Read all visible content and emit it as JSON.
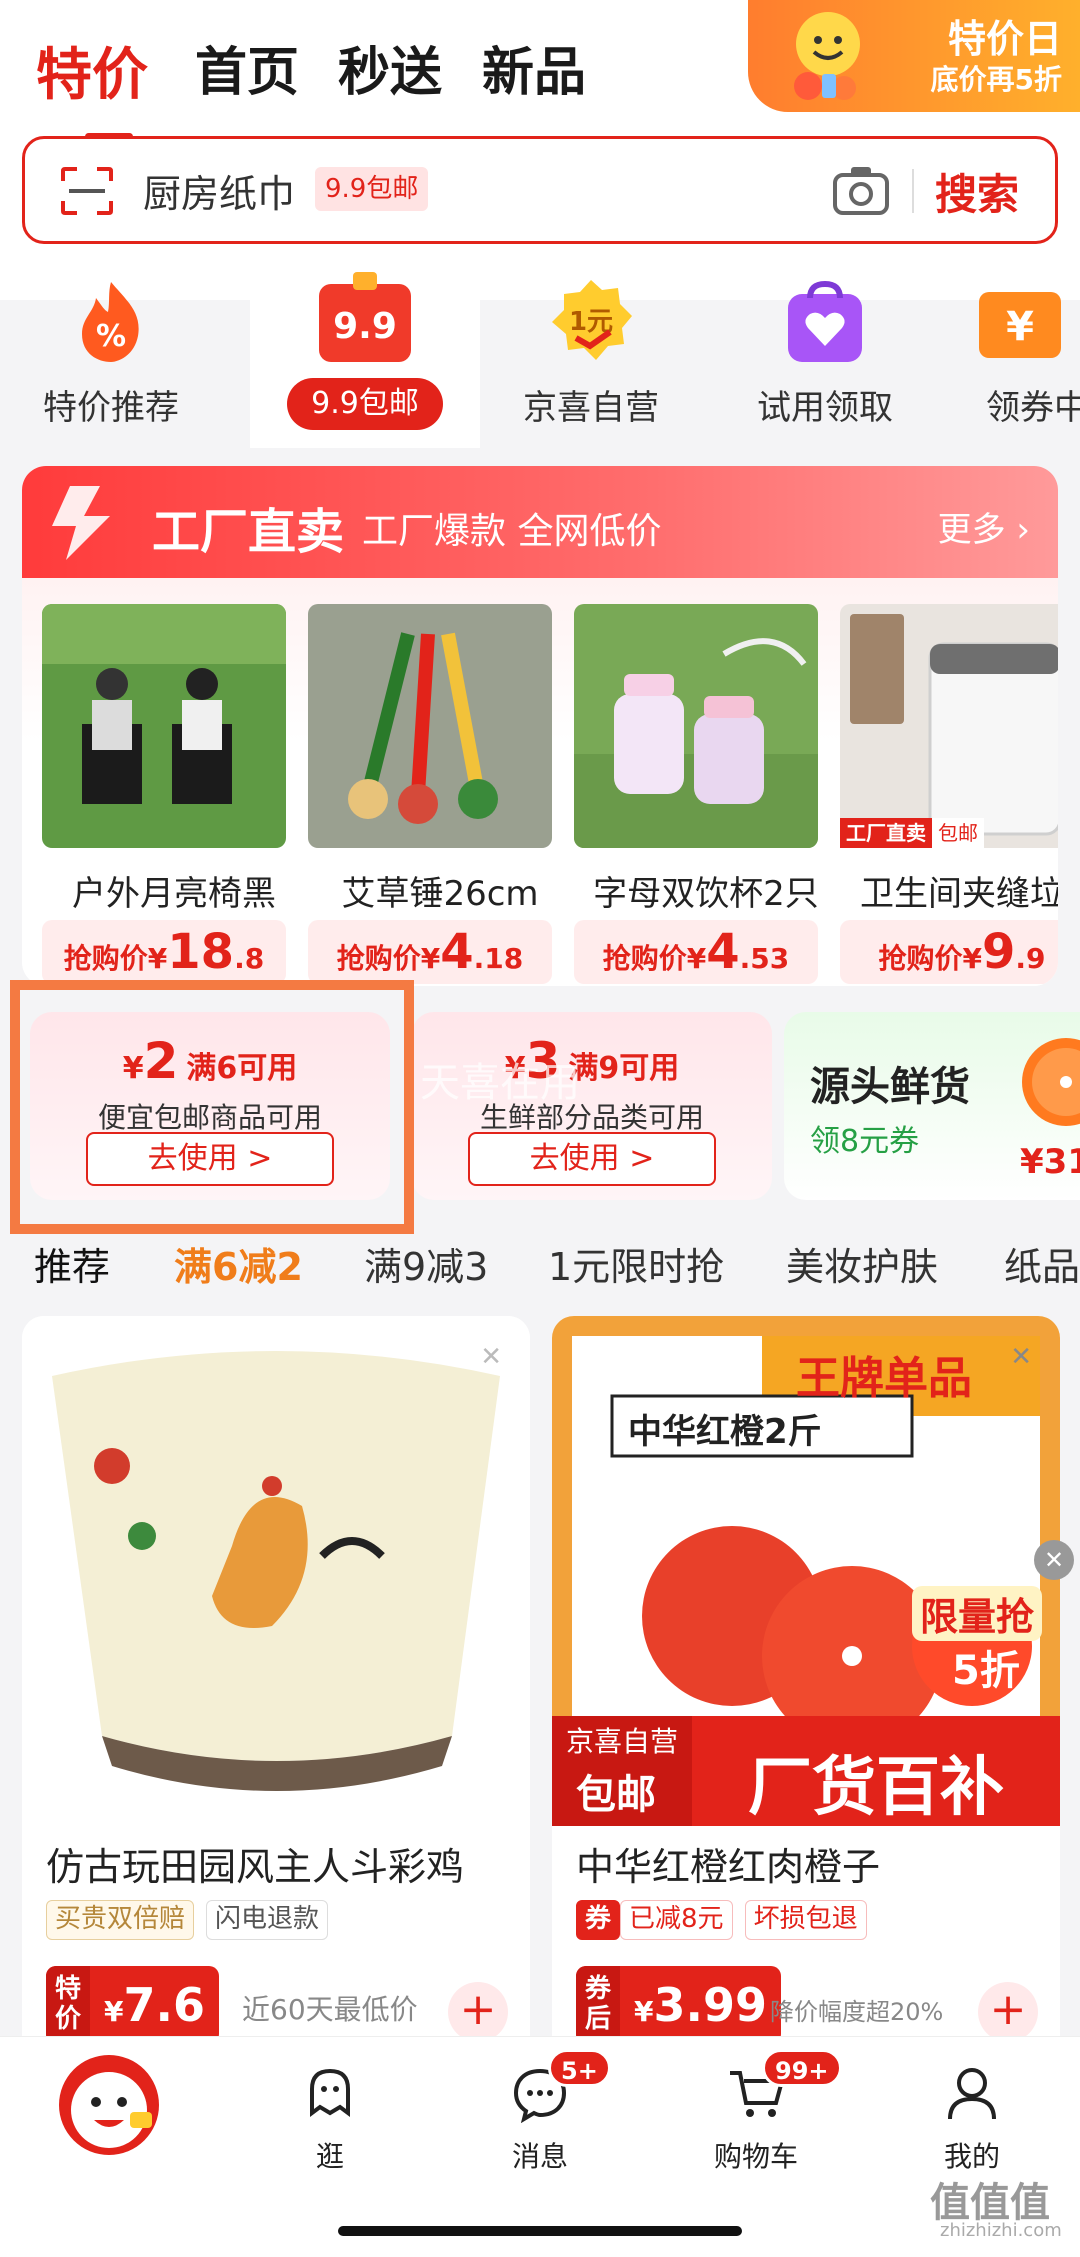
{
  "top_tabs": [
    {
      "label": "特价",
      "active": true
    },
    {
      "label": "首页"
    },
    {
      "label": "秒送"
    },
    {
      "label": "新品"
    }
  ],
  "promo_banner": {
    "line1": "特价日",
    "line2": "底价再5折"
  },
  "search": {
    "text": "厨房纸巾",
    "tag": "9.9包邮",
    "button": "搜索"
  },
  "categories": [
    {
      "label": "特价推荐",
      "icon": "fire-percent-icon"
    },
    {
      "label": "9.9包邮",
      "icon": "gift-box-9-9-icon",
      "selected": true,
      "icon_text": "9.9"
    },
    {
      "label": "京喜自营",
      "icon": "gold-coin-1yuan-icon",
      "icon_text": "1元"
    },
    {
      "label": "试用领取",
      "icon": "shopping-bag-heart-icon"
    },
    {
      "label": "领券中",
      "icon": "coupon-yen-icon"
    }
  ],
  "factory": {
    "title": "工厂直卖",
    "subtitle": "工厂爆款 全网低价",
    "more": "更多",
    "products": [
      {
        "name": "户外月亮椅黑",
        "price_label": "抢购价",
        "currency": "¥",
        "price_int": "18",
        "price_dec": ".8"
      },
      {
        "name": "艾草锤26cm",
        "price_label": "抢购价",
        "currency": "¥",
        "price_int": "4",
        "price_dec": ".18"
      },
      {
        "name": "字母双饮杯2只",
        "price_label": "抢购价",
        "currency": "¥",
        "price_int": "4",
        "price_dec": ".53"
      },
      {
        "name": "卫生间夹缝垃",
        "price_label": "抢购价",
        "currency": "¥",
        "price_int": "9",
        "price_dec": ".9",
        "badge1": "工厂直卖",
        "badge2": "包邮"
      }
    ]
  },
  "coupons": [
    {
      "currency": "¥",
      "amount": "2",
      "condition": "满6可用",
      "desc": "便宜包邮商品可用",
      "button": "去使用 >"
    },
    {
      "currency": "¥",
      "amount": "3",
      "condition": "满9可用",
      "desc": "生鲜部分品类可用",
      "button": "去使用 >"
    }
  ],
  "fresh": {
    "title": "源头鲜货",
    "subtitle": "领8元券",
    "price": "¥31."
  },
  "watermark": "天喜在用",
  "filters": [
    {
      "label": "推荐"
    },
    {
      "label": "满6减2",
      "active": true
    },
    {
      "label": "满9减3"
    },
    {
      "label": "1元限时抢"
    },
    {
      "label": "美妆护肤"
    },
    {
      "label": "纸品"
    }
  ],
  "cards": [
    {
      "title": "仿古玩田园风主人斗彩鸡",
      "tags": [
        "买贵双倍赔",
        "闪电退款"
      ],
      "price_label": "特价",
      "currency": "¥",
      "price": "7.6",
      "note": "近60天最低价"
    },
    {
      "title": "中华红橙红肉橙子",
      "tags": [
        "券",
        "已减8元",
        "坏损包退"
      ],
      "price_label": "券后",
      "currency": "¥",
      "price": "3.99",
      "note": "降价幅度超20%",
      "img_banner": "王牌单品",
      "img_sub": "中华红橙2斤",
      "img_limit": "限量抢",
      "img_discount": "5折",
      "img_badge1": "京喜自营",
      "img_badge2": "包邮",
      "img_slogan": "厂货百补"
    }
  ],
  "bottom_nav": [
    {
      "label": "",
      "icon": "mascot-icon"
    },
    {
      "label": "逛",
      "icon": "ghost-icon"
    },
    {
      "label": "消息",
      "icon": "chat-bubble-icon",
      "badge": "5+"
    },
    {
      "label": "购物车",
      "icon": "cart-icon",
      "badge": "99+"
    },
    {
      "label": "我的",
      "icon": "person-icon"
    }
  ],
  "site_mark": "值值值",
  "site_url": "zhizhizhi.com",
  "colors": {
    "brand_red": "#e2231a",
    "highlight_orange": "#f47a42",
    "filter_active": "#f07d1a"
  }
}
